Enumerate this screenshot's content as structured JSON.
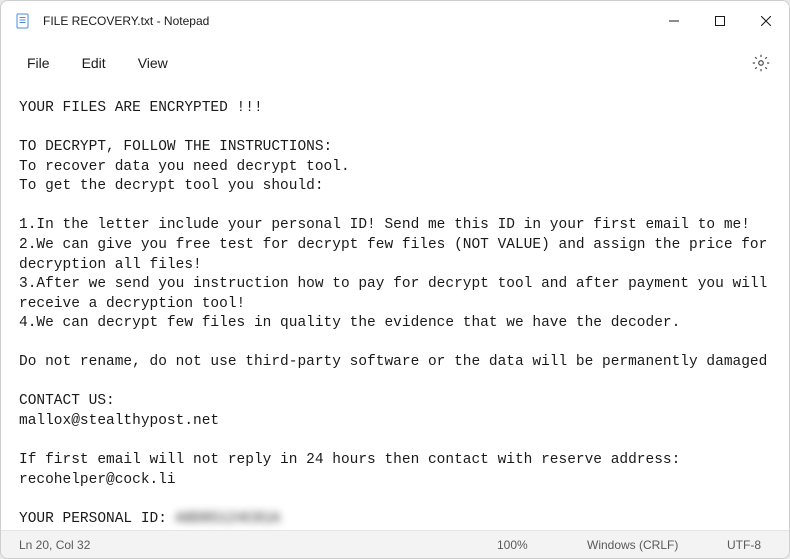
{
  "titlebar": {
    "title": "FILE RECOVERY.txt - Notepad"
  },
  "menu": {
    "file": "File",
    "edit": "Edit",
    "view": "View"
  },
  "content": {
    "l1": "YOUR FILES ARE ENCRYPTED !!!",
    "l2": "",
    "l3": "TO DECRYPT, FOLLOW THE INSTRUCTIONS:",
    "l4": "To recover data you need decrypt tool.",
    "l5": "To get the decrypt tool you should:",
    "l6": "",
    "l7": "1.In the letter include your personal ID! Send me this ID in your first email to me!",
    "l8": "2.We can give you free test for decrypt few files (NOT VALUE) and assign the price for decryption all files!",
    "l9": "3.After we send you instruction how to pay for decrypt tool and after payment you will receive a decryption tool!",
    "l10": "4.We can decrypt few files in quality the evidence that we have the decoder.",
    "l11": "",
    "l12": "Do not rename, do not use third-party software or the data will be permanently damaged",
    "l13": "",
    "l14": "CONTACT US:",
    "l15": "mallox@stealthypost.net",
    "l16": "",
    "l17": "If first email will not reply in 24 hours then contact with reserve address:",
    "l18": "recohelper@cock.li",
    "l19": "",
    "l20_prefix": "YOUR PERSONAL ID: ",
    "l20_id": "A8D85124C81A"
  },
  "statusbar": {
    "cursor": "Ln 20, Col 32",
    "zoom": "100%",
    "eol": "Windows (CRLF)",
    "encoding": "UTF-8"
  }
}
